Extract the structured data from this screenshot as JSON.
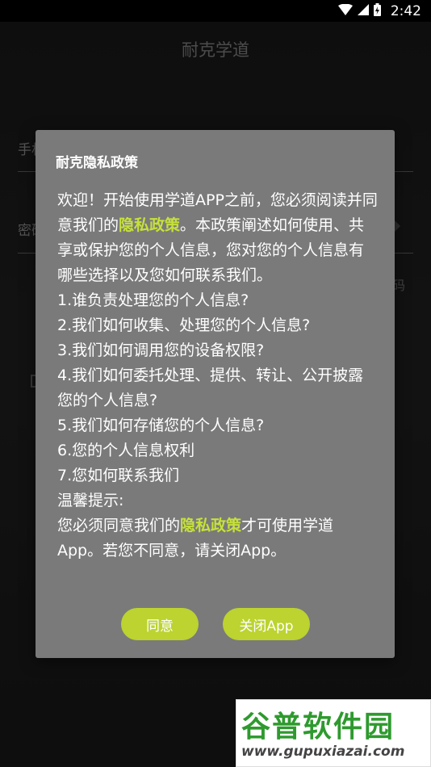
{
  "status_bar": {
    "time": "2:42"
  },
  "app": {
    "title": "耐克学道",
    "phone_label": "手机",
    "password_label": "密码",
    "side_text": "码"
  },
  "dialog": {
    "title": "耐克隐私政策",
    "intro_part1": "欢迎！开始使用学道APP之前，您必须阅读并同意我们的",
    "privacy_link_1": "隐私政策",
    "intro_part2": "。本政策阐述如何使用、共享或保护您的个人信息，您对您的个人信息有哪些选择以及您如何联系我们。",
    "items": [
      "1.谁负责处理您的个人信息?",
      "2.我们如何收集、处理您的个人信息?",
      "3.我们如何调用您的设备权限?",
      "4.我们如何委托处理、提供、转让、公开披露您的个人信息?",
      "5.我们如何存储您的个人信息?",
      "6.您的个人信息权利",
      "7.您如何联系我们"
    ],
    "tip_title": "温馨提示:",
    "tip_part1": "您必须同意我们的",
    "privacy_link_2": "隐私政策",
    "tip_part2": "才可使用学道App。若您不同意，请关闭App。",
    "agree_label": "同意",
    "close_label": "关闭App"
  },
  "watermark": {
    "logo_text": "谷普软件园",
    "url": "www.gupuxiazai.com"
  },
  "colors": {
    "accent": "#bcd330",
    "link": "#c6e13b",
    "dialog_bg": "#7a7a7a"
  }
}
